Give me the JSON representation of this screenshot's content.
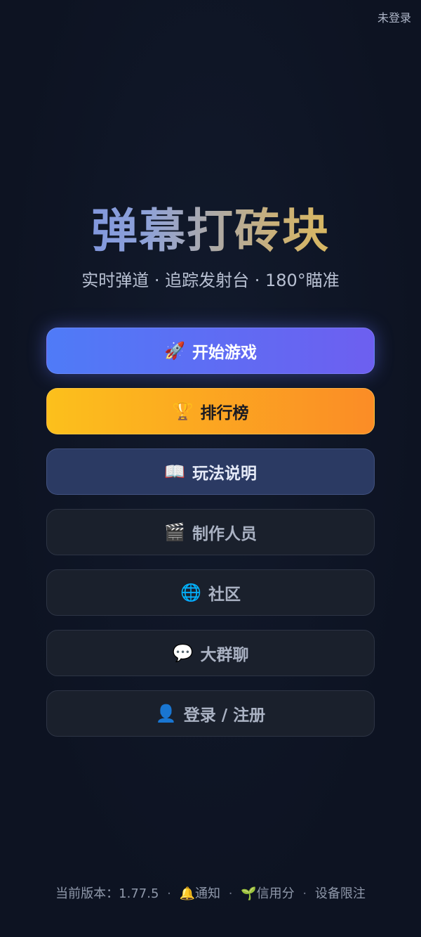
{
  "header": {
    "login_status": "未登录"
  },
  "hero": {
    "title": "弹幕打砖块",
    "subtitle": "实时弹道 · 追踪发射台 · 180°瞄准"
  },
  "menu": {
    "start": {
      "icon": "🚀",
      "icon_name": "rocket-icon",
      "label": "开始游戏"
    },
    "leaderboard": {
      "icon": "🏆",
      "icon_name": "trophy-icon",
      "label": "排行榜"
    },
    "howto": {
      "icon": "📖",
      "icon_name": "book-icon",
      "label": "玩法说明"
    },
    "credits": {
      "icon": "🎬",
      "icon_name": "clapperboard-icon",
      "label": "制作人员"
    },
    "community": {
      "icon": "🌐",
      "icon_name": "globe-icon",
      "label": "社区"
    },
    "group_chat": {
      "icon": "💬",
      "icon_name": "speech-bubble-icon",
      "label": "大群聊"
    },
    "login": {
      "icon": "👤",
      "icon_name": "user-icon",
      "label": "登录 / 注册"
    }
  },
  "footer": {
    "version_label": "当前版本：1.77.5",
    "separator": "·",
    "notice_icon": "🔔",
    "notice_label": "通知",
    "credit_icon": "🌱",
    "credit_label": "信用分",
    "device_label": "设备限注"
  },
  "colors": {
    "background": "#0d1322",
    "start_gradient": [
      "#4f7bf7",
      "#6d5ff0"
    ],
    "rank_gradient": [
      "#fcc01c",
      "#fb8c26"
    ],
    "howto_bg": "#2b3a63",
    "dark_button_bg": "#1a202c"
  }
}
